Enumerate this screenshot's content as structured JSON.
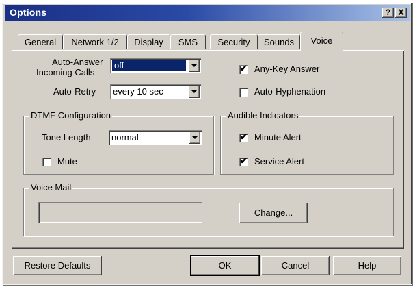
{
  "window": {
    "title": "Options",
    "help_btn": "?",
    "close_btn": "X"
  },
  "tabs": [
    {
      "label": "General"
    },
    {
      "label": "Network 1/2"
    },
    {
      "label": "Display"
    },
    {
      "label": "SMS"
    },
    {
      "label": "Security"
    },
    {
      "label": "Sounds"
    },
    {
      "label": "Voice",
      "active": true
    }
  ],
  "voice": {
    "auto_answer_label_1": "Auto-Answer",
    "auto_answer_label_2": "Incoming Calls",
    "auto_answer_value": "off",
    "auto_retry_label": "Auto-Retry",
    "auto_retry_value": "every 10 sec",
    "any_key_answer": {
      "label": "Any-Key Answer",
      "checked": true
    },
    "auto_hyphenation": {
      "label": "Auto-Hyphenation",
      "checked": false
    },
    "dtmf": {
      "title": "DTMF Configuration",
      "tone_length_label": "Tone Length",
      "tone_length_value": "normal",
      "mute": {
        "label": "Mute",
        "checked": false
      }
    },
    "audible": {
      "title": "Audible Indicators",
      "minute_alert": {
        "label": "Minute Alert",
        "checked": true
      },
      "service_alert": {
        "label": "Service Alert",
        "checked": true
      }
    },
    "voice_mail": {
      "title": "Voice Mail",
      "value": "",
      "change_button": "Change..."
    }
  },
  "footer": {
    "restore_defaults": "Restore Defaults",
    "ok": "OK",
    "cancel": "Cancel",
    "help": "Help"
  },
  "colors": {
    "title_gradient_start": "#1a2f86",
    "title_gradient_end": "#a9c2e8",
    "dialog_face": "#d4d0c8",
    "selection": "#0a246a"
  },
  "check_mark": "✔"
}
